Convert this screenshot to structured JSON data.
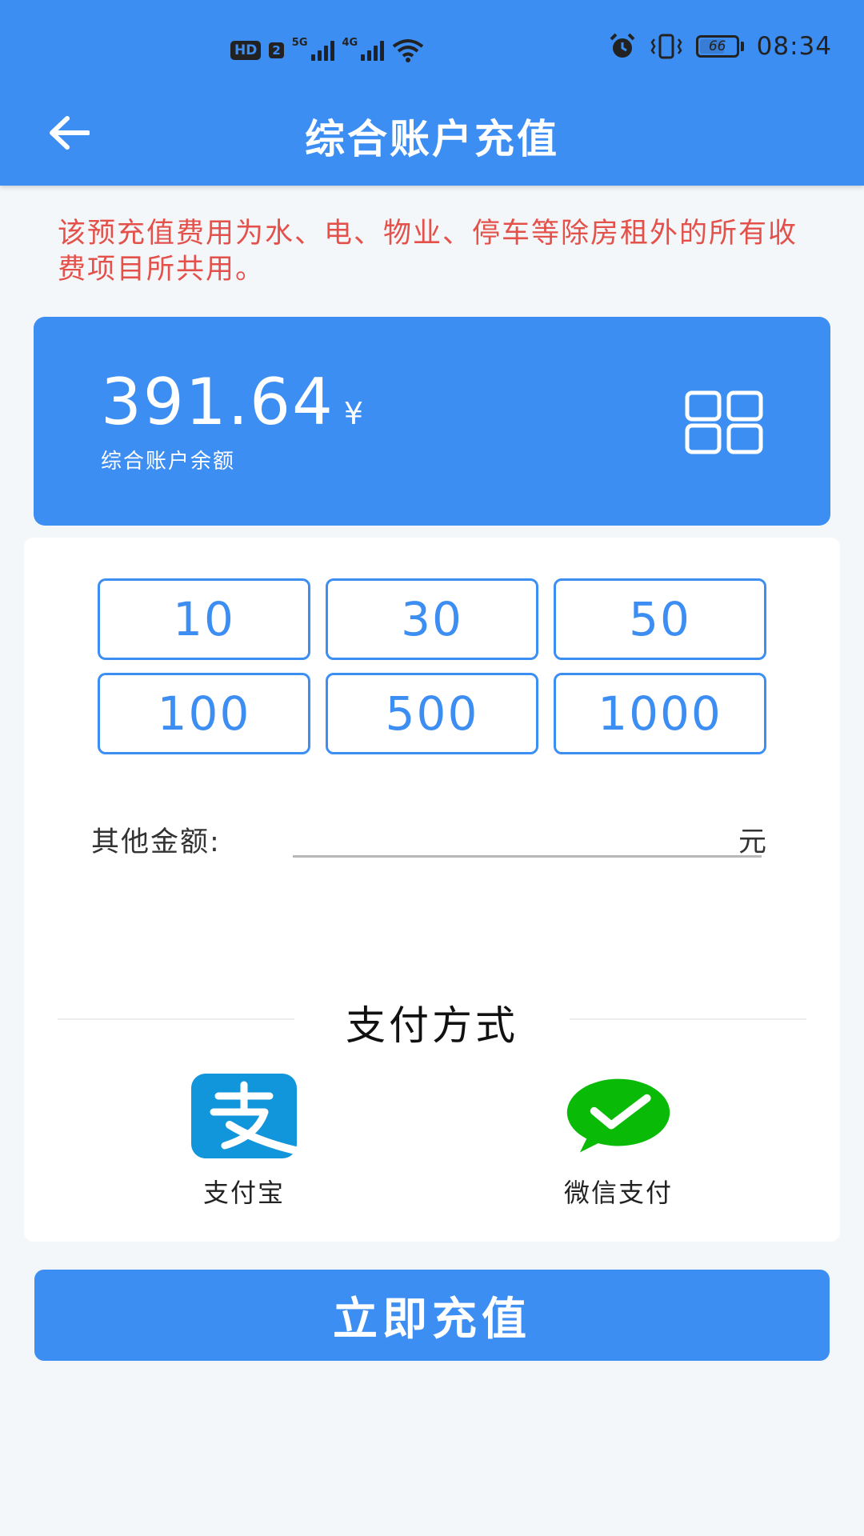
{
  "status_bar": {
    "hd_badge": "HD",
    "sim_badge": "2",
    "network_1": "5G",
    "network_2": "4G",
    "battery_level": "66",
    "time": "08:34",
    "icons": [
      "signal-icon",
      "wifi-icon",
      "alarm-icon",
      "vibrate-icon",
      "battery-icon"
    ]
  },
  "header": {
    "title": "综合账户充值",
    "back_icon": "arrow-left-icon"
  },
  "notice": "该预充值费用为水、电、物业、停车等除房租外的所有收费项目所共用。",
  "balance": {
    "amount": "391.64",
    "currency": "¥",
    "label": "综合账户余额",
    "icon": "grid-icon"
  },
  "amount_options": [
    "10",
    "30",
    "50",
    "100",
    "500",
    "1000"
  ],
  "other_amount": {
    "label": "其他金额:",
    "value": "",
    "placeholder": "",
    "unit": "元"
  },
  "payment": {
    "title": "支付方式",
    "methods": [
      {
        "label": "支付宝",
        "icon": "alipay-icon",
        "color": "#1296db"
      },
      {
        "label": "微信支付",
        "icon": "wechat-pay-icon",
        "color": "#09bb07"
      }
    ]
  },
  "submit_label": "立即充值",
  "colors": {
    "primary": "#3d8ef3",
    "notice_text": "#e4514b",
    "background": "#f4f7fa"
  }
}
